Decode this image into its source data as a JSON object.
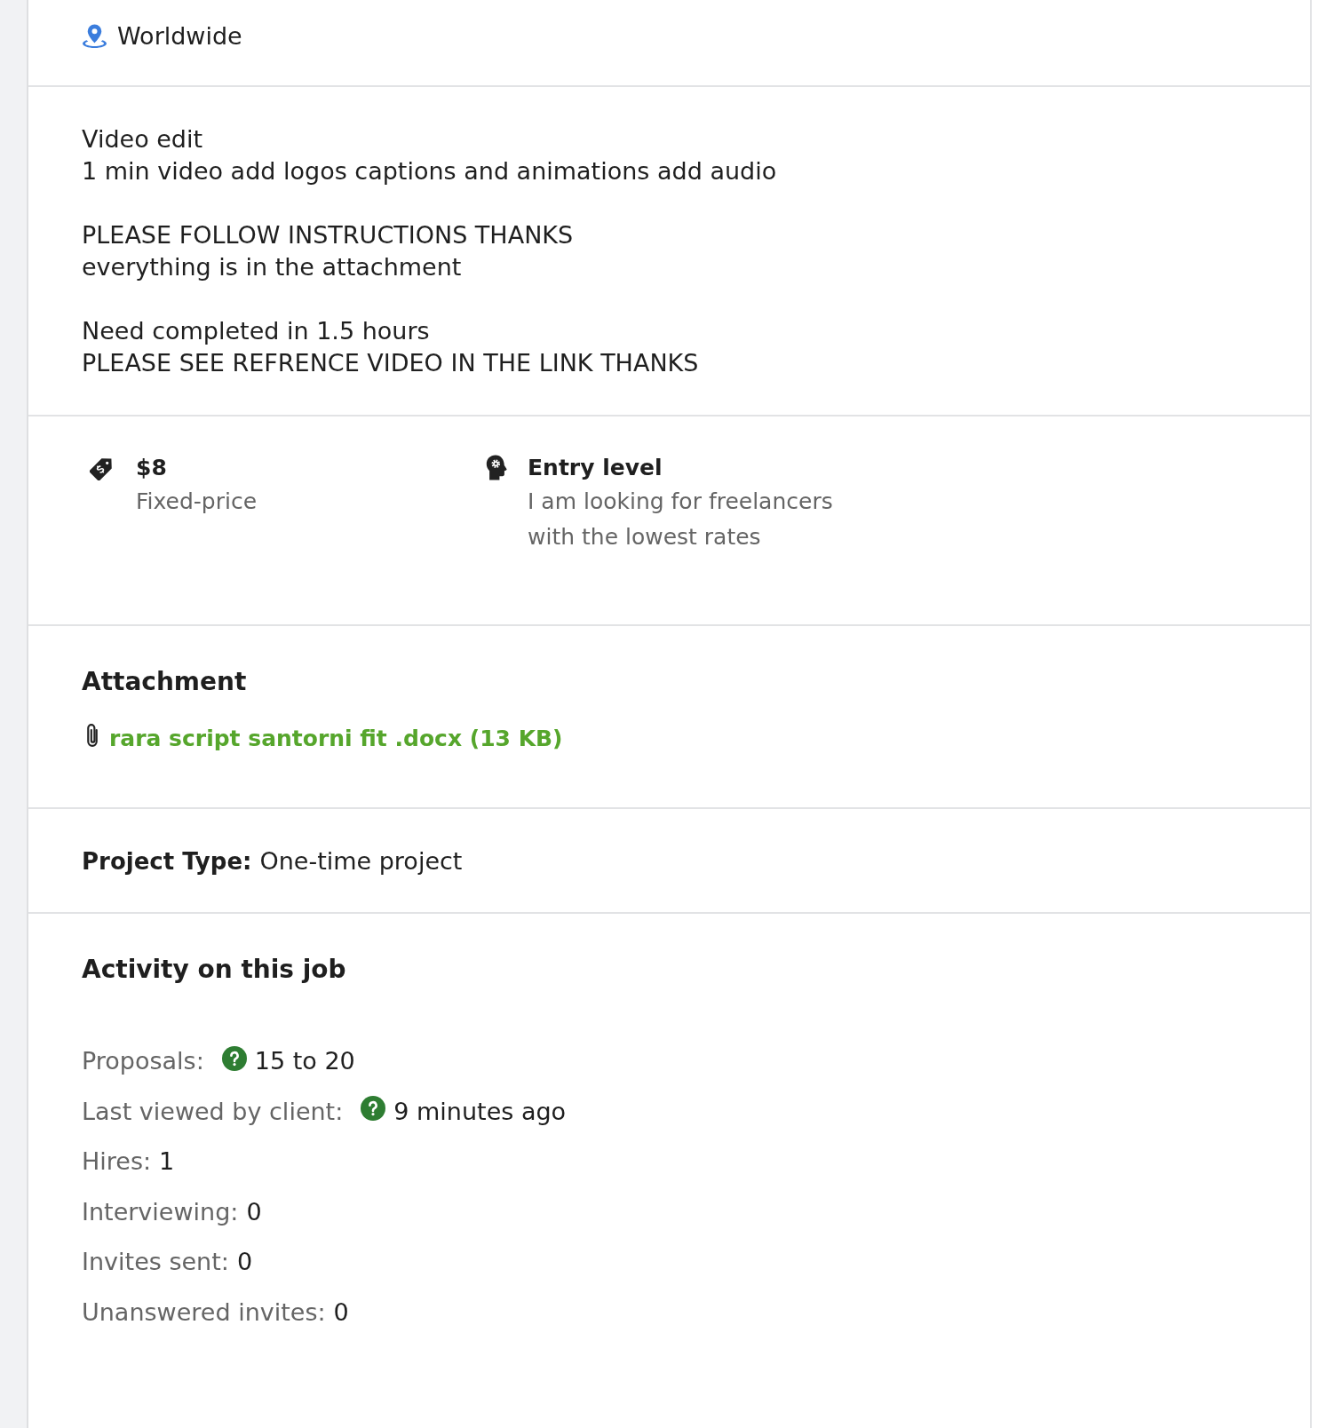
{
  "location": {
    "text": "Worldwide"
  },
  "description": {
    "paragraphs": [
      {
        "lines": [
          "Video edit",
          "1 min video add logos captions and animations add audio"
        ]
      },
      {
        "lines": [
          "PLEASE FOLLOW INSTRUCTIONS THANKS",
          "everything is in the attachment"
        ]
      },
      {
        "lines": [
          "Need completed in 1.5 hours",
          "PLEASE SEE REFRENCE VIDEO IN THE LINK THANKS"
        ]
      }
    ]
  },
  "details": [
    {
      "kind": "price",
      "title": "$8",
      "subtitle": "Fixed-price"
    },
    {
      "kind": "level",
      "title": "Entry level",
      "subtitle": "I am looking for freelancers with the lowest rates"
    }
  ],
  "attachment": {
    "heading": "Attachment",
    "file": "rara script santorni fit .docx (13 KB)"
  },
  "project_type": {
    "label": "Project Type:",
    "value": "One-time project"
  },
  "activity": {
    "heading": "Activity on this job",
    "items": [
      {
        "label": "Proposals:",
        "value": "15 to 20",
        "help": true
      },
      {
        "label": "Last viewed by client:",
        "value": "9 minutes ago",
        "help": true
      },
      {
        "label": "Hires:",
        "value": "1",
        "help": false
      },
      {
        "label": "Interviewing:",
        "value": "0",
        "help": false
      },
      {
        "label": "Invites sent:",
        "value": "0",
        "help": false
      },
      {
        "label": "Unanswered invites:",
        "value": "0",
        "help": false
      }
    ]
  }
}
